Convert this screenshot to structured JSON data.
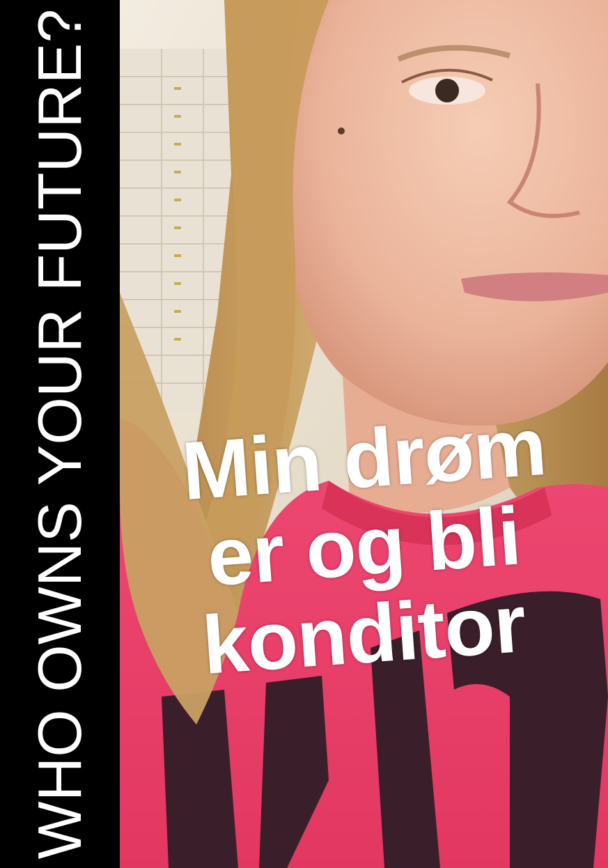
{
  "side_title": "WHO OWNS YOUR FUTURE?",
  "caption": {
    "lines": [
      "Min drøm",
      "er og bli",
      "konditor"
    ]
  },
  "colors": {
    "band": "#000000",
    "text": "#ffffff",
    "sweater_pink": "#f2446e",
    "sweater_print": "#3a1f2a",
    "hair": "#c9a063",
    "skin": "#f1c2a8",
    "wall": "#efe6d6"
  }
}
